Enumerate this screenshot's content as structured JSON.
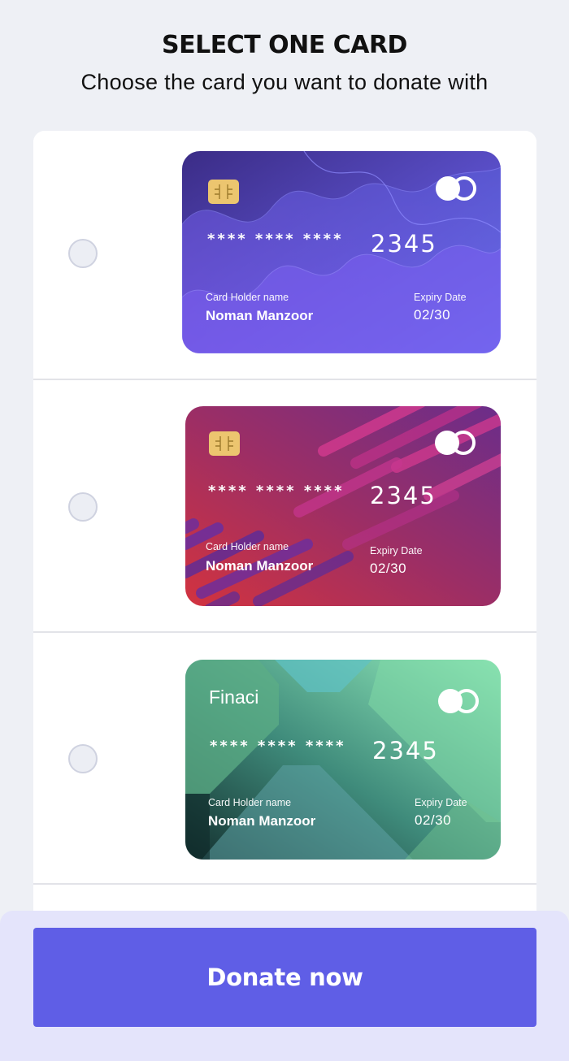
{
  "header": {
    "title": "SELECT ONE CARD",
    "subtitle": "Choose the card you want to donate with"
  },
  "cards": [
    {
      "masked": "**** **** ****",
      "last4": "2345",
      "holder_label": "Card Holder name",
      "holder_name": "Noman Manzoor",
      "expiry_label": "Expiry Date",
      "expiry": "02/30",
      "selected": false,
      "theme_colors": [
        "#3e2f8e",
        "#7b63f2",
        "#6a78f4"
      ]
    },
    {
      "masked": "**** **** ****",
      "last4": "2345",
      "holder_label": "Card Holder name",
      "holder_name": "Noman Manzoor",
      "expiry_label": "Expiry Date",
      "expiry": "02/30",
      "selected": false,
      "theme_colors": [
        "#c9344a",
        "#8a2e6b",
        "#6e2b86"
      ]
    },
    {
      "bank_name": "Finaci",
      "masked": "**** **** ****",
      "last4": "2345",
      "holder_label": "Card Holder name",
      "holder_name": "Noman Manzoor",
      "expiry_label": "Expiry Date",
      "expiry": "02/30",
      "selected": false,
      "theme_colors": [
        "#1d3b3a",
        "#4f9e8a",
        "#8ee6b8"
      ]
    }
  ],
  "footer": {
    "donate_label": "Donate now",
    "accent": "#5f5ee6"
  }
}
